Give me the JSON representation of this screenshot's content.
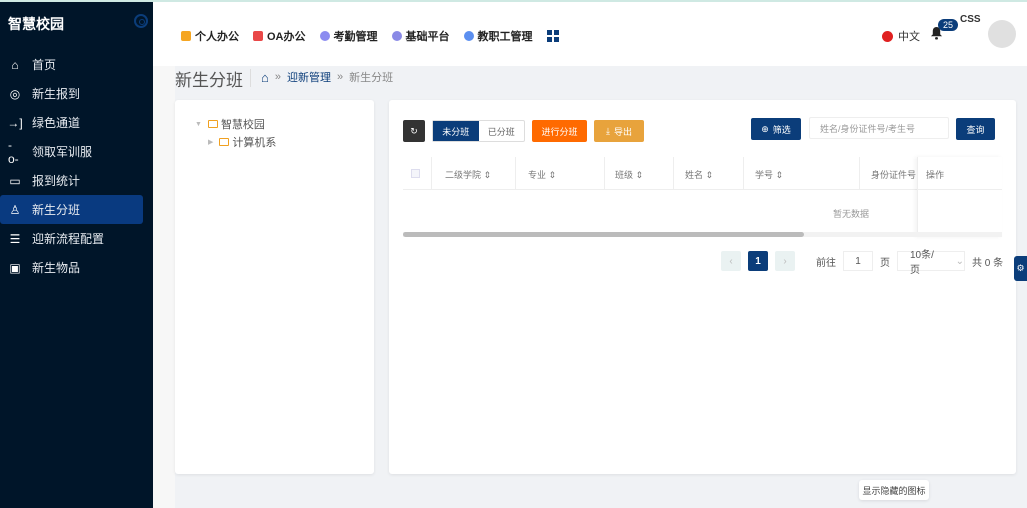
{
  "sidebar": {
    "logo": "智慧校园",
    "items": [
      {
        "label": "首页",
        "icon": "home-icon"
      },
      {
        "label": "新生报到",
        "icon": "target-icon"
      },
      {
        "label": "绿色通道",
        "icon": "login-icon"
      },
      {
        "label": "领取军训服",
        "icon": "commit-icon"
      },
      {
        "label": "报到统计",
        "icon": "inbox-icon"
      },
      {
        "label": "新生分班",
        "icon": "user-icon",
        "active": true
      },
      {
        "label": "迎新流程配置",
        "icon": "list-icon"
      },
      {
        "label": "新生物品",
        "icon": "archive-icon"
      }
    ]
  },
  "topbar": {
    "nav": [
      {
        "label": "个人办公",
        "color": "#f5a623"
      },
      {
        "label": "OA办公",
        "color": "#e94848"
      },
      {
        "label": "考勤管理",
        "color": "#8c8cf0"
      },
      {
        "label": "基础平台",
        "color": "#8a8ae6"
      },
      {
        "label": "教职工管理",
        "color": "#5b8ff0"
      }
    ],
    "language": "中文",
    "notification_count": "25",
    "username": "CSS"
  },
  "page": {
    "title": "新生分班",
    "breadcrumb": [
      "迎新管理",
      "新生分班"
    ],
    "breadcrumb_sep": "»"
  },
  "tree": {
    "root": "智慧校园",
    "children": [
      "计算机系"
    ]
  },
  "toolbar": {
    "tab_unassigned": "未分班",
    "tab_assigned": "已分班",
    "assign_label": "进行分班",
    "export_label": "导出",
    "filter_label": "筛选",
    "search_placeholder": "姓名/身份证件号/考生号",
    "query_label": "查询"
  },
  "table": {
    "columns": [
      "二级学院",
      "专业",
      "班级",
      "姓名",
      "学号",
      "身份证件号",
      "操作"
    ],
    "empty_text": "暂无数据"
  },
  "pagination": {
    "current_page": "1",
    "goto_label": "前往",
    "goto_value": "1",
    "page_unit": "页",
    "page_size": "10条/页",
    "total": "共 0 条"
  },
  "show_hidden_icons": "显示隐藏的图标"
}
